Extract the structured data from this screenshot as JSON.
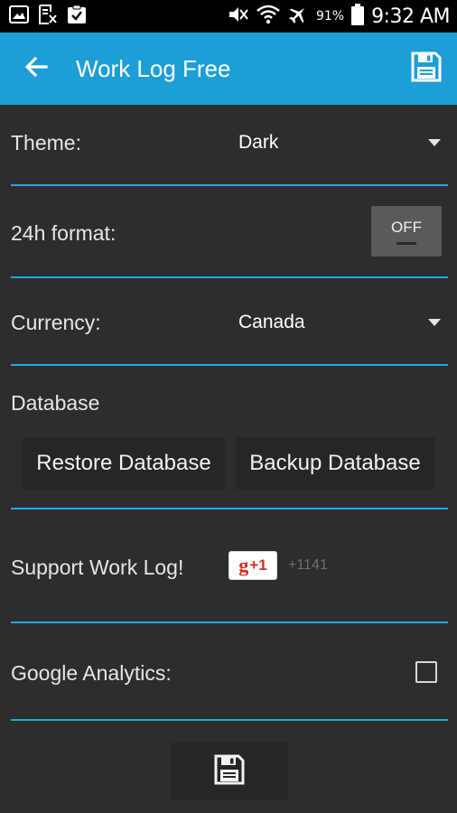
{
  "status_bar": {
    "battery_percent": "91%",
    "time": "9:32 AM",
    "left_icons": [
      "image-icon",
      "document-icon",
      "clipboard-check-icon"
    ],
    "right_icons": [
      "mute-icon",
      "wifi-icon",
      "airplane-icon",
      "battery-icon"
    ]
  },
  "app_bar": {
    "title": "Work Log Free",
    "background": "#1e9ed6",
    "back_icon": "arrow-left-icon",
    "save_icon": "floppy-disk-icon"
  },
  "settings": {
    "theme": {
      "label": "Theme:",
      "value": "Dark"
    },
    "time_format": {
      "label": "24h format:",
      "toggle_label": "OFF",
      "enabled": false
    },
    "currency": {
      "label": "Currency:",
      "value": "Canada"
    },
    "database": {
      "label": "Database",
      "restore_label": "Restore Database",
      "backup_label": "Backup Database"
    },
    "support": {
      "label": "Support Work Log!",
      "gplus_g": "g",
      "gplus_plus": "+1",
      "plus_count": "+1141"
    },
    "analytics": {
      "label": "Google Analytics:",
      "checked": false
    }
  },
  "accent_divider_color": "#2aa6d8",
  "bottom_save_icon": "floppy-disk-icon"
}
